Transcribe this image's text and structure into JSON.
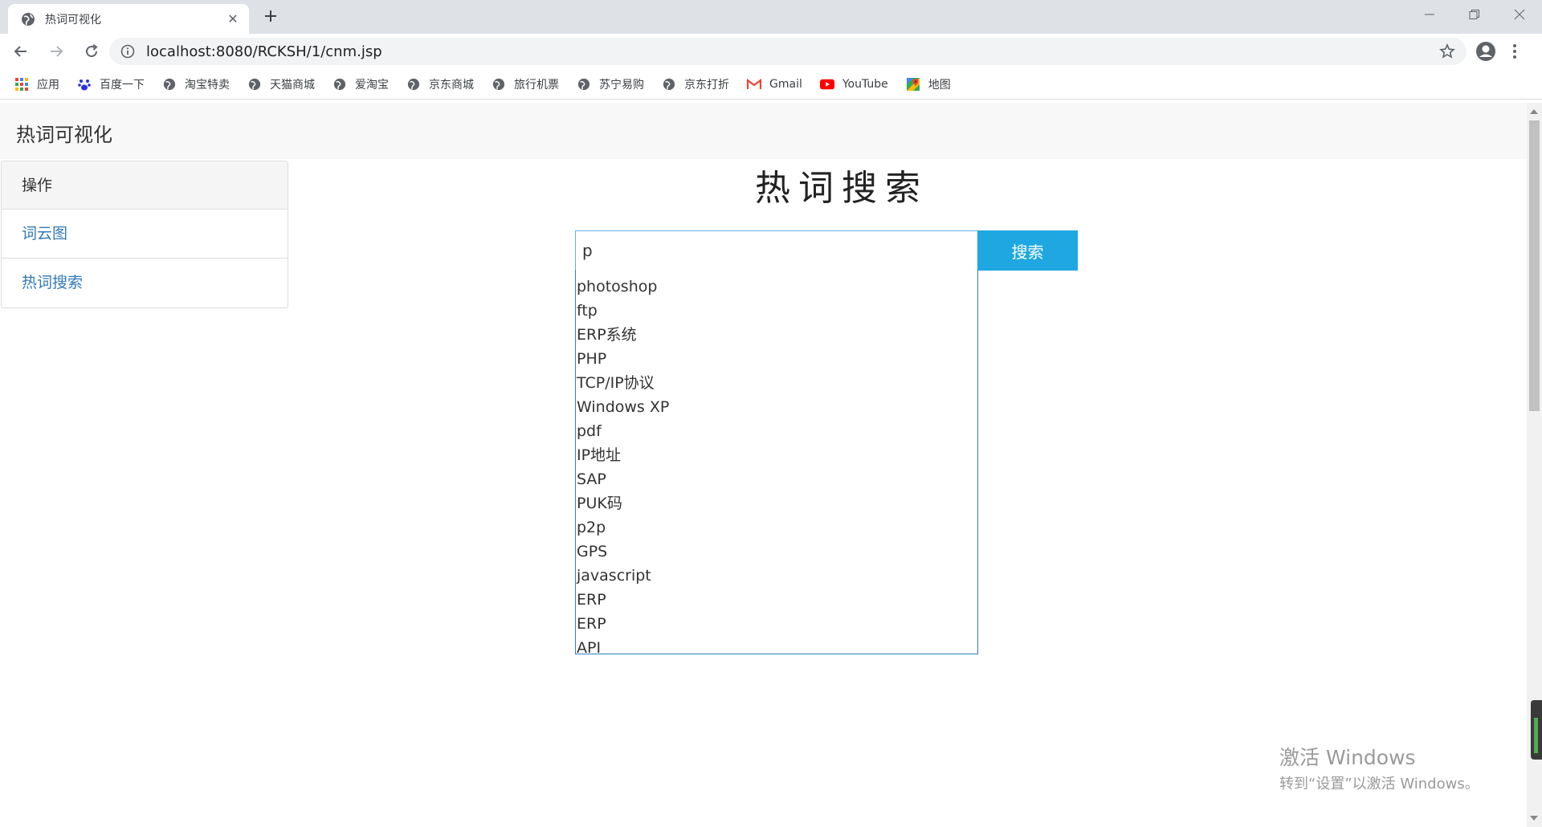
{
  "browser": {
    "tab_title": "热词可视化",
    "url": "localhost:8080/RCKSH/1/cnm.jsp",
    "bookmarks": [
      {
        "label": "应用",
        "icon": "apps-grid-icon"
      },
      {
        "label": "百度一下",
        "icon": "baidu-paw-icon"
      },
      {
        "label": "淘宝特卖",
        "icon": "globe-icon"
      },
      {
        "label": "天猫商城",
        "icon": "globe-icon"
      },
      {
        "label": "爱淘宝",
        "icon": "globe-icon"
      },
      {
        "label": "京东商城",
        "icon": "globe-icon"
      },
      {
        "label": "旅行机票",
        "icon": "globe-icon"
      },
      {
        "label": "苏宁易购",
        "icon": "globe-icon"
      },
      {
        "label": "京东打折",
        "icon": "globe-icon"
      },
      {
        "label": "Gmail",
        "icon": "gmail-icon"
      },
      {
        "label": "YouTube",
        "icon": "youtube-icon"
      },
      {
        "label": "地图",
        "icon": "maps-icon"
      }
    ]
  },
  "page": {
    "brand": "热词可视化",
    "sidebar": {
      "heading": "操作",
      "items": [
        {
          "label": "词云图"
        },
        {
          "label": "热词搜索"
        }
      ]
    },
    "title": "热词搜索",
    "search": {
      "value": "p",
      "button_label": "搜索"
    },
    "suggestions": [
      "photoshop",
      "ftp",
      "ERP系统",
      "PHP",
      "TCP/IP协议",
      "Windows XP",
      "pdf",
      "IP地址",
      "SAP",
      "PUK码",
      "p2p",
      "GPS",
      "javascript",
      "ERP",
      "ERP",
      "API"
    ]
  },
  "overlay": {
    "activate_line1": "激活 Windows",
    "activate_line2": "转到“设置”以激活 Windows。"
  },
  "colors": {
    "link": "#337ab7",
    "search_button": "#1ea7e1",
    "input_border": "#66afe9"
  }
}
